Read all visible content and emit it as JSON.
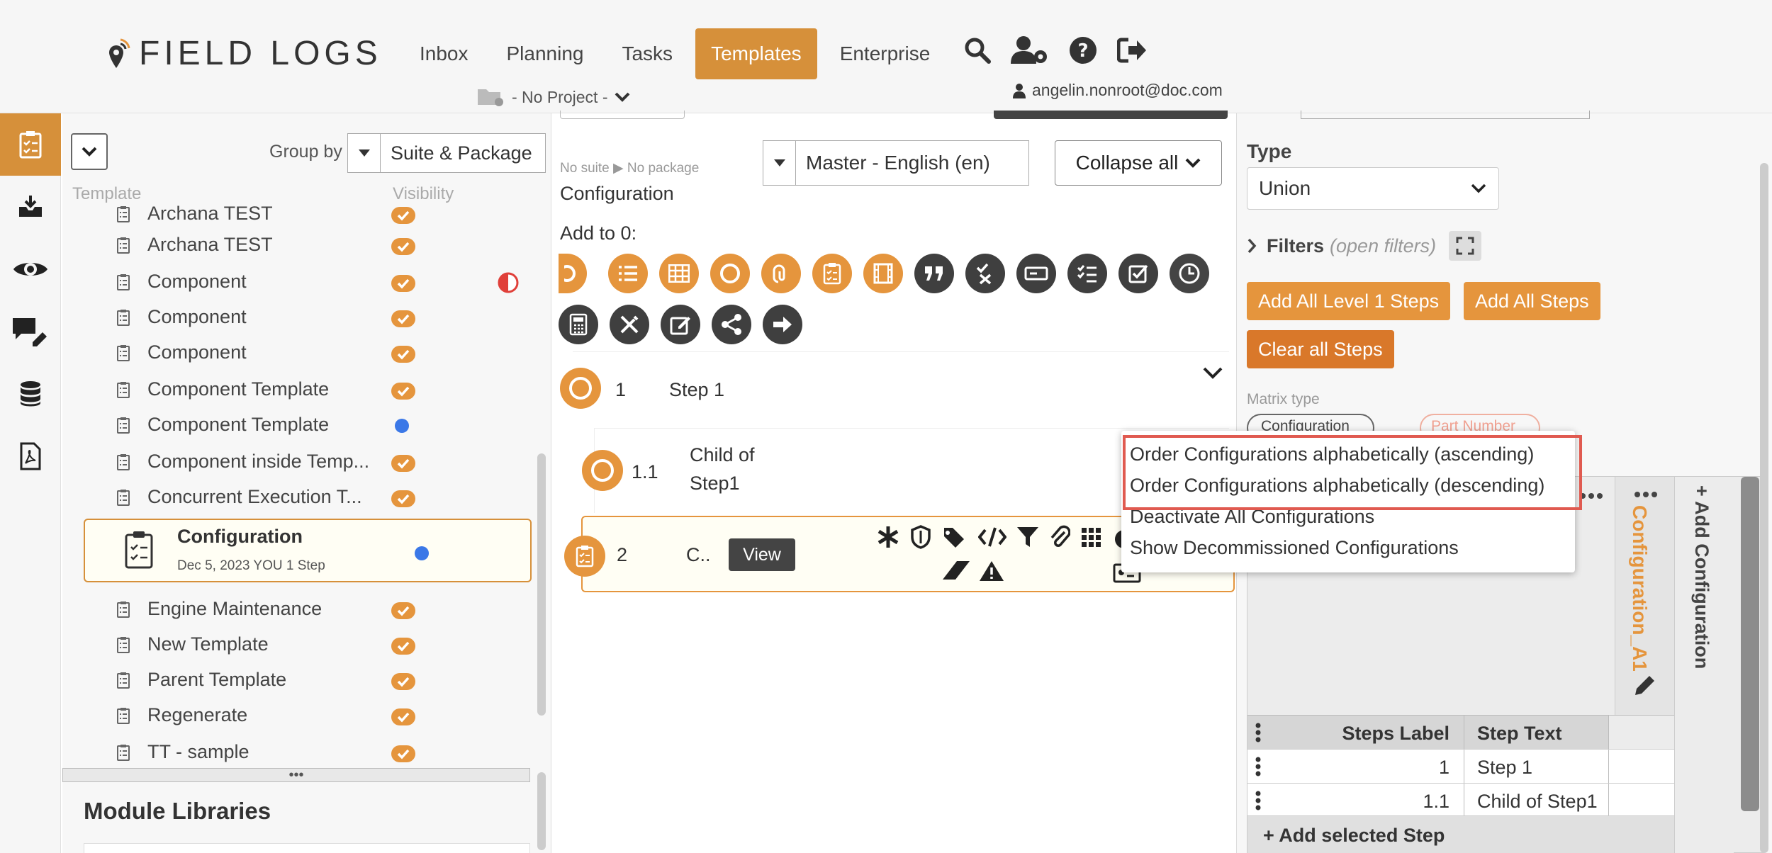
{
  "header": {
    "logo_text": "FIELD LOGS",
    "nav": [
      "Inbox",
      "Planning",
      "Tasks",
      "Templates",
      "Enterprise"
    ],
    "active_nav": "Templates",
    "project": "- No Project -",
    "user_email": "angelin.nonroot@doc.com",
    "icons": [
      "search-icon",
      "user-settings-icon",
      "help-icon",
      "logout-icon"
    ]
  },
  "rail": {
    "icons": [
      "templates-icon",
      "inbox-download-icon",
      "view-eye-icon",
      "comments-icon",
      "database-icon",
      "pdf-icon"
    ],
    "active": "templates-icon"
  },
  "templates_panel": {
    "group_by_label": "Group by",
    "group_by_value": "Suite & Package",
    "col_template": "Template",
    "col_visibility": "Visibility",
    "items": [
      {
        "name": "Archana TEST",
        "vis": "check"
      },
      {
        "name": "Archana TEST",
        "vis": "check"
      },
      {
        "name": "Component",
        "vis": "check",
        "extra": "half-circle"
      },
      {
        "name": "Component",
        "vis": "check"
      },
      {
        "name": "Component",
        "vis": "check"
      },
      {
        "name": "Component Template",
        "vis": "check"
      },
      {
        "name": "Component Template",
        "vis": "dot"
      },
      {
        "name": "Component inside Temp...",
        "vis": "check"
      },
      {
        "name": "Concurrent Execution T...",
        "vis": "check"
      },
      {
        "name": "Engine Maintenance",
        "vis": "check"
      },
      {
        "name": "New Template",
        "vis": "check"
      },
      {
        "name": "Parent Template",
        "vis": "check"
      },
      {
        "name": "Regenerate",
        "vis": "check"
      },
      {
        "name": "TT - sample",
        "vis": "check"
      }
    ],
    "selected": {
      "name": "Configuration",
      "meta": "Dec 5, 2023  YOU  1 Step",
      "vis": "dot"
    },
    "module_title": "Module Libraries",
    "colors": {
      "accent": "#d6903a",
      "check": "#e5953d",
      "dot": "#3b78e7"
    }
  },
  "editor": {
    "breadcrumb_suite": "No suite",
    "breadcrumb_package": "No package",
    "title": "Configuration",
    "language": "Master - English (en)",
    "collapse_label": "Collapse all",
    "add_to_label": "Add to 0:",
    "steps": [
      {
        "num": "1",
        "label": "Step 1"
      },
      {
        "num": "1.1",
        "label_line1": "Child of",
        "label_line2": "Step1"
      },
      {
        "num": "2",
        "label": "C..",
        "view_label": "View"
      }
    ]
  },
  "right_panel": {
    "type_label": "Type",
    "type_value": "Union",
    "filters_label": "Filters",
    "filters_hint": "(open filters)",
    "btn_add_level1": "Add All Level 1 Steps",
    "btn_add_all": "Add All Steps",
    "btn_clear": "Clear all Steps",
    "matrix_type_label": "Matrix type",
    "chip_configuration": "Configuration",
    "chip_part_number": "Part Number",
    "config_column": "Configuration_A1",
    "add_configuration": "+ Add Configuration",
    "table": {
      "headers": [
        "Steps Label",
        "Step Text"
      ],
      "rows": [
        {
          "label": "1",
          "text": "Step 1"
        },
        {
          "label": "1.1",
          "text": "Child of Step1"
        }
      ]
    },
    "add_selected_step": "+ Add selected Step"
  },
  "menu": {
    "items": [
      "Order Configurations alphabetically (ascending)",
      "Order Configurations alphabetically (descending)",
      "Deactivate All Configurations",
      "Show Decommissioned Configurations"
    ],
    "highlight_color": "#e05a50"
  }
}
